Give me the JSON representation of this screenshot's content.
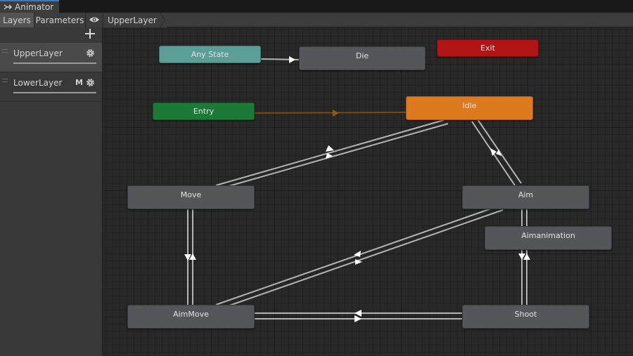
{
  "window": {
    "tab_title": "Animator"
  },
  "toolbar": {
    "layers_label": "Layers",
    "parameters_label": "Parameters",
    "breadcrumb": "UpperLayer"
  },
  "sidebar": {
    "layers": [
      {
        "name": "UpperLayer",
        "badge": ""
      },
      {
        "name": "LowerLayer",
        "badge": "M"
      }
    ]
  },
  "graph": {
    "states": {
      "any_state": "Any State",
      "die": "Die",
      "exit": "Exit",
      "entry": "Entry",
      "idle": "Idle",
      "move": "Move",
      "aim": "Aim",
      "aimanimation": "Aimanimation",
      "aimmove": "AimMove",
      "shoot": "Shoot"
    }
  },
  "colors": {
    "any_state": "#5b9e98",
    "entry": "#1c7a36",
    "exit": "#b01414",
    "default_state": "#dd7a1e",
    "normal_state": "#545659",
    "transition": "#b4b4b4",
    "default_transition": "#7a4a12",
    "tab_accent": "#3a79bb"
  }
}
